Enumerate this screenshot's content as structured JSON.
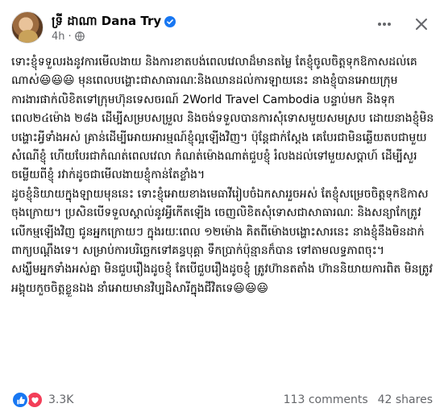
{
  "post": {
    "author": "ទ្រី ដាណា Dana Try",
    "time": "4h",
    "body": "ទោះខ្ញុំទទួលរងនូវការមើលងាយ និងការខាតបង់ពេលវេលាដ៏មានតម្លៃ តែខ្ញុំចូលចិត្តទុកឱកាសដល់គេណាស់😃😃😃 មុនពេលបង្ហោះជាសាធារណៈនិងឈានដល់ការឡាយនេះ នាងខ្ញុំបានអោយក្រុមការងារផាក់លិខិតទៅក្រុមហ៊ុនទេសចរណ៍ 2World Travel Cambodia បន្ទាប់មក និងទុកពេល២៤ម៉ោង ២៨ង ដើម្បីសម្របសម្រួល និងចង់ទទួលបានការសុំទោសមួយសមស្រប ដោយនាងខ្ញុំមិនបង្ហោះអ្វីទាំងអស់ គ្រាន់ដើម្បីអោយអារម្មណ៍ខ្ញុំល្អឡើងវិញ។ ប៉ុន្តែជាក់ស្តែង គេបែរជាមិនឆ្លើយតបជាមួយសំណើខ្ញុំ ហើយបែរជាកំណត់ពេលវេលា កំណត់ម៉ោងណាត់ជួបខ្ញុំ រំលងដល់ទៅមួយសប្តាហ៍ ដើម្បីសួរចម្លើយពីខ្ញុំ រវាក់ដូចជាមើលងាយខ្ញុំកាន់តែខ្លាំង។\nដូចខ្ញុំនិយាយក្នុងឡាយមុននេះ ទោះខ្ញុំអោយខាងមេធាវីរៀបចំឯកសាររួចអស់ តែខ្ញុំសម្រេចចិត្តទុកឱកាសចុងក្រោយ។ ប្រសិនបើទទួលស្គាល់នូវអ្វីកើតឡើង ចេញលិខិតសុំទោសជាសាធារណៈ និងសន្យាកែត្រូវលើកម្មឡើងវិញ ជូនអ្នកក្រោយៗ ក្នុងរយៈពេល ១២ម៉ោង គិតពីម៉ោងបង្ហោះសារនេះ នាងខ្ញុំនឹងមិនដាក់ពាក្យបណ្តឹងទេ។ សម្រាប់ការបរិច្ឆេកទៅគន្ធបុគ្គា ទឹកប្រាក់ប៉ុន្មានក៏បាន ទៅតាមលទ្ធភាពចុះ។\nសង្ឃឹមអ្នកទាំងអស់គ្នា មិនជួបរឿងដូចខ្ញុំ តែបើជួបរឿងដូចខ្ញុំ ត្រូវហ៊ានតតាំង ហ៊ាននិយាយការពិត មិនត្រូវអង្គុយកួចចិត្តខ្លួនឯង នាំអោយមានវិប្បដិសារីក្នុងជីវិតទេ😃😃😃"
  },
  "engagement": {
    "reactions_count": "3.3K",
    "comments_label": "113 comments",
    "shares_label": "42 shares"
  },
  "icons": {
    "verified": "verified-icon",
    "globe": "globe-icon",
    "more": "more-icon",
    "close": "close-icon",
    "like": "like-icon",
    "love": "love-icon"
  },
  "colors": {
    "brand_blue": "#1877f2",
    "love_red": "#f33e58",
    "secondary_text": "#65676b"
  }
}
